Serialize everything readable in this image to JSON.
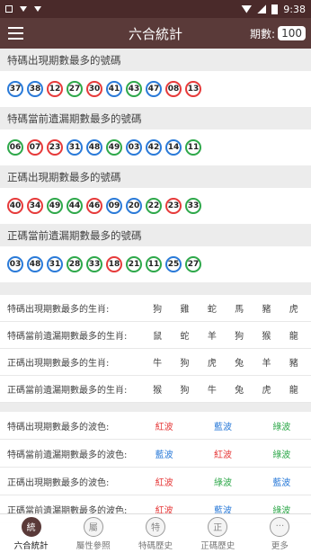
{
  "statusbar": {
    "time": "9:38"
  },
  "topbar": {
    "title": "六合統計",
    "period_label": "期數:",
    "period_value": "100"
  },
  "sections": [
    {
      "title": "特碼出現期數最多的號碼",
      "balls": [
        {
          "n": "37",
          "c": "blue"
        },
        {
          "n": "38",
          "c": "blue"
        },
        {
          "n": "12",
          "c": "red"
        },
        {
          "n": "27",
          "c": "green"
        },
        {
          "n": "30",
          "c": "red"
        },
        {
          "n": "41",
          "c": "blue"
        },
        {
          "n": "43",
          "c": "green"
        },
        {
          "n": "47",
          "c": "blue"
        },
        {
          "n": "08",
          "c": "red"
        },
        {
          "n": "13",
          "c": "red"
        }
      ]
    },
    {
      "title": "特碼當前遺漏期數最多的號碼",
      "balls": [
        {
          "n": "06",
          "c": "green"
        },
        {
          "n": "07",
          "c": "red"
        },
        {
          "n": "23",
          "c": "red"
        },
        {
          "n": "31",
          "c": "blue"
        },
        {
          "n": "48",
          "c": "blue"
        },
        {
          "n": "49",
          "c": "green"
        },
        {
          "n": "03",
          "c": "blue"
        },
        {
          "n": "42",
          "c": "blue"
        },
        {
          "n": "14",
          "c": "blue"
        },
        {
          "n": "11",
          "c": "green"
        }
      ]
    },
    {
      "title": "正碼出現期數最多的號碼",
      "balls": [
        {
          "n": "40",
          "c": "red"
        },
        {
          "n": "34",
          "c": "red"
        },
        {
          "n": "49",
          "c": "green"
        },
        {
          "n": "44",
          "c": "green"
        },
        {
          "n": "46",
          "c": "red"
        },
        {
          "n": "09",
          "c": "blue"
        },
        {
          "n": "20",
          "c": "blue"
        },
        {
          "n": "22",
          "c": "green"
        },
        {
          "n": "23",
          "c": "red"
        },
        {
          "n": "33",
          "c": "green"
        }
      ]
    },
    {
      "title": "正碼當前遺漏期數最多的號碼",
      "balls": [
        {
          "n": "03",
          "c": "blue"
        },
        {
          "n": "48",
          "c": "blue"
        },
        {
          "n": "31",
          "c": "blue"
        },
        {
          "n": "28",
          "c": "green"
        },
        {
          "n": "33",
          "c": "green"
        },
        {
          "n": "18",
          "c": "red"
        },
        {
          "n": "21",
          "c": "green"
        },
        {
          "n": "11",
          "c": "green"
        },
        {
          "n": "25",
          "c": "blue"
        },
        {
          "n": "27",
          "c": "green"
        }
      ]
    }
  ],
  "zodiac_rows": [
    {
      "label": "特碼出現期數最多的生肖:",
      "values": [
        "狗",
        "雞",
        "蛇",
        "馬",
        "豬",
        "虎"
      ]
    },
    {
      "label": "特碼當前遺漏期數最多的生肖:",
      "values": [
        "鼠",
        "蛇",
        "羊",
        "狗",
        "猴",
        "龍"
      ]
    },
    {
      "label": "正碼出現期數最多的生肖:",
      "values": [
        "牛",
        "狗",
        "虎",
        "兔",
        "羊",
        "豬"
      ]
    },
    {
      "label": "正碼當前遺漏期數最多的生肖:",
      "values": [
        "猴",
        "狗",
        "牛",
        "兔",
        "虎",
        "龍"
      ]
    }
  ],
  "wave_rows": [
    {
      "label": "特碼出現期數最多的波色:",
      "values": [
        {
          "t": "紅波",
          "c": "red"
        },
        {
          "t": "藍波",
          "c": "blue"
        },
        {
          "t": "綠波",
          "c": "green"
        }
      ]
    },
    {
      "label": "特碼當前遺漏期數最多的波色:",
      "values": [
        {
          "t": "藍波",
          "c": "blue"
        },
        {
          "t": "紅波",
          "c": "red"
        },
        {
          "t": "綠波",
          "c": "green"
        }
      ]
    },
    {
      "label": "正碼出現期數最多的波色:",
      "values": [
        {
          "t": "紅波",
          "c": "red"
        },
        {
          "t": "綠波",
          "c": "green"
        },
        {
          "t": "藍波",
          "c": "blue"
        }
      ]
    },
    {
      "label": "正碼當前遺漏期數最多的波色:",
      "values": [
        {
          "t": "紅波",
          "c": "red"
        },
        {
          "t": "藍波",
          "c": "blue"
        },
        {
          "t": "綠波",
          "c": "green"
        }
      ]
    }
  ],
  "nav": [
    {
      "glyph": "統",
      "label": "六合統計",
      "active": true
    },
    {
      "glyph": "屬",
      "label": "屬性參照",
      "active": false
    },
    {
      "glyph": "特",
      "label": "特碼歷史",
      "active": false
    },
    {
      "glyph": "正",
      "label": "正碼歷史",
      "active": false
    },
    {
      "glyph": "···",
      "label": "更多",
      "active": false
    }
  ],
  "colors": {
    "header": "#5a3a39",
    "red": "#e63a3a",
    "blue": "#2a7ad8",
    "green": "#2ea84a"
  }
}
